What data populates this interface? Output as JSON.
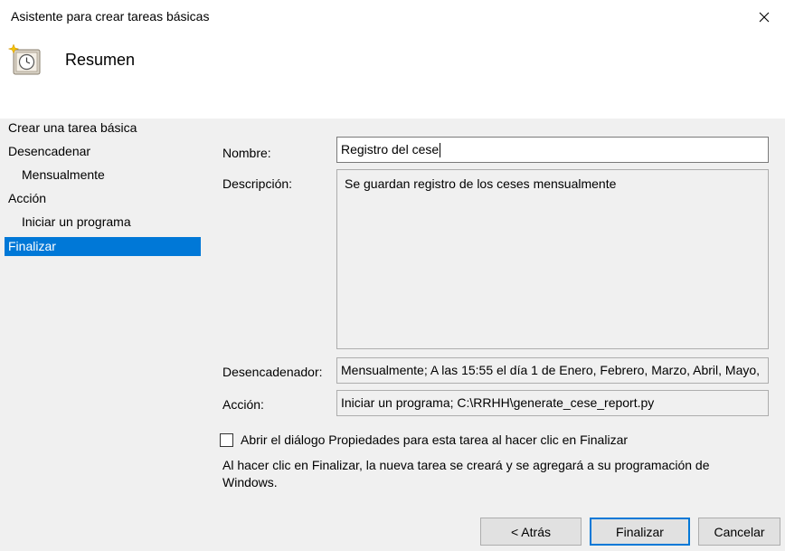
{
  "window": {
    "title": "Asistente para crear tareas básicas",
    "close_icon": "close-icon"
  },
  "header": {
    "icon": "clock-wizard-icon",
    "heading": "Resumen"
  },
  "nav": {
    "items": [
      {
        "label": "Crear una tarea básica",
        "level": 0,
        "selected": false
      },
      {
        "label": "Desencadenar",
        "level": 0,
        "selected": false
      },
      {
        "label": "Mensualmente",
        "level": 1,
        "selected": false
      },
      {
        "label": "Acción",
        "level": 0,
        "selected": false
      },
      {
        "label": "Iniciar un programa",
        "level": 1,
        "selected": false
      },
      {
        "label": "Finalizar",
        "level": 0,
        "selected": true
      }
    ]
  },
  "form": {
    "name_label": "Nombre:",
    "name_value": "Registro del cese",
    "description_label": "Descripción:",
    "description_value": "Se guardan registro de los ceses mensualmente",
    "trigger_label": "Desencadenador:",
    "trigger_value": "Mensualmente; A las 15:55 el día 1 de Enero, Febrero, Marzo, Abril, Mayo,",
    "action_label": "Acción:",
    "action_value": "Iniciar un programa; C:\\RRHH\\generate_cese_report.py"
  },
  "options": {
    "open_properties_checked": false,
    "open_properties_label": "Abrir el diálogo Propiedades para esta tarea al hacer clic en Finalizar",
    "info_text": "Al hacer clic en Finalizar, la nueva tarea se creará y se agregará a su programación de Windows."
  },
  "buttons": {
    "back": "< Atrás",
    "finish": "Finalizar",
    "cancel": "Cancelar"
  },
  "colors": {
    "accent": "#0078d7",
    "background": "#f0f0f0"
  }
}
